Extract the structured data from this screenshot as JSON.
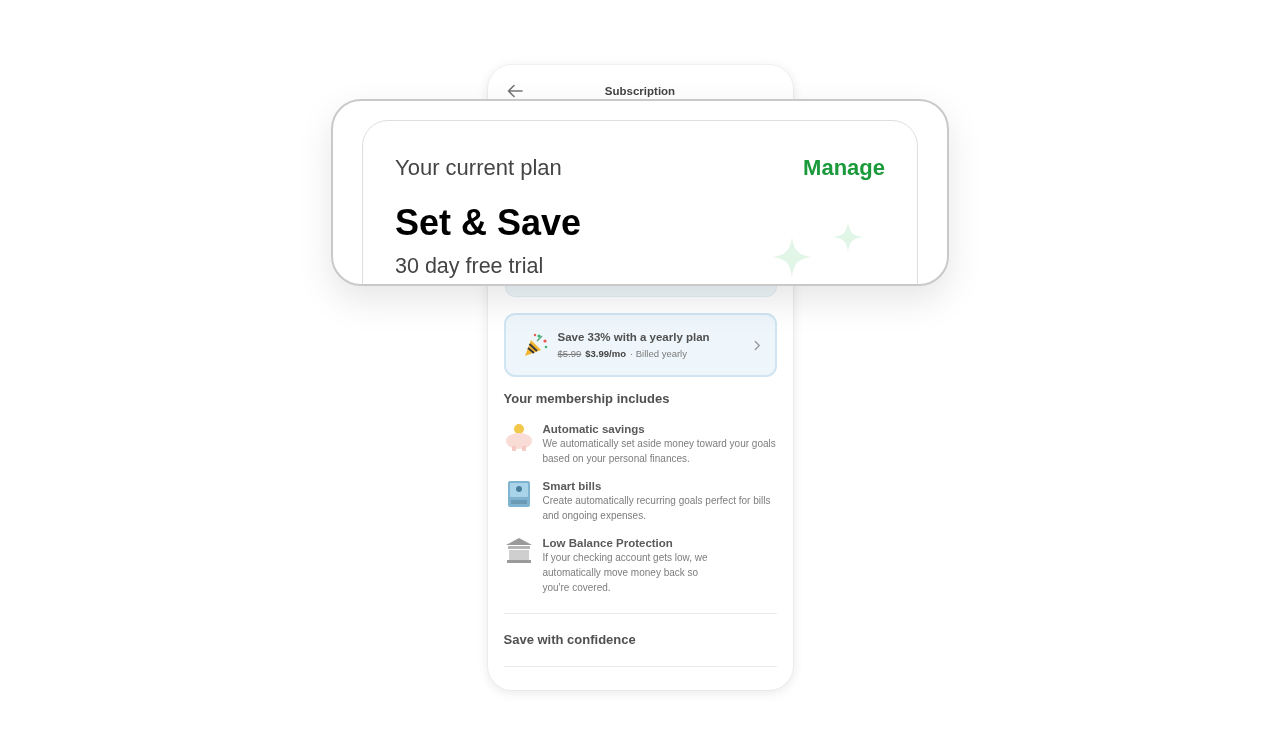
{
  "header": {
    "title": "Subscription"
  },
  "current_plan": {
    "label": "Your current plan",
    "action": "Manage",
    "name": "Set & Save",
    "trial": "30 day free trial"
  },
  "yearly_offer": {
    "title": "Save 33% with a yearly plan",
    "old_price": "$5.99",
    "price": "$3.99/mo",
    "note": "· Billed yearly"
  },
  "membership": {
    "title": "Your membership includes",
    "features": [
      {
        "title": "Automatic savings",
        "description": "We automatically set aside money toward your goals based on your personal finances."
      },
      {
        "title": "Smart bills",
        "description": "Create automatically recurring goals perfect for bills and ongoing expenses."
      },
      {
        "title": "Low Balance Protection",
        "description": "If your checking account gets low, we automatically move money back so you're covered."
      }
    ]
  },
  "next_section": {
    "title": "Save with confidence"
  }
}
